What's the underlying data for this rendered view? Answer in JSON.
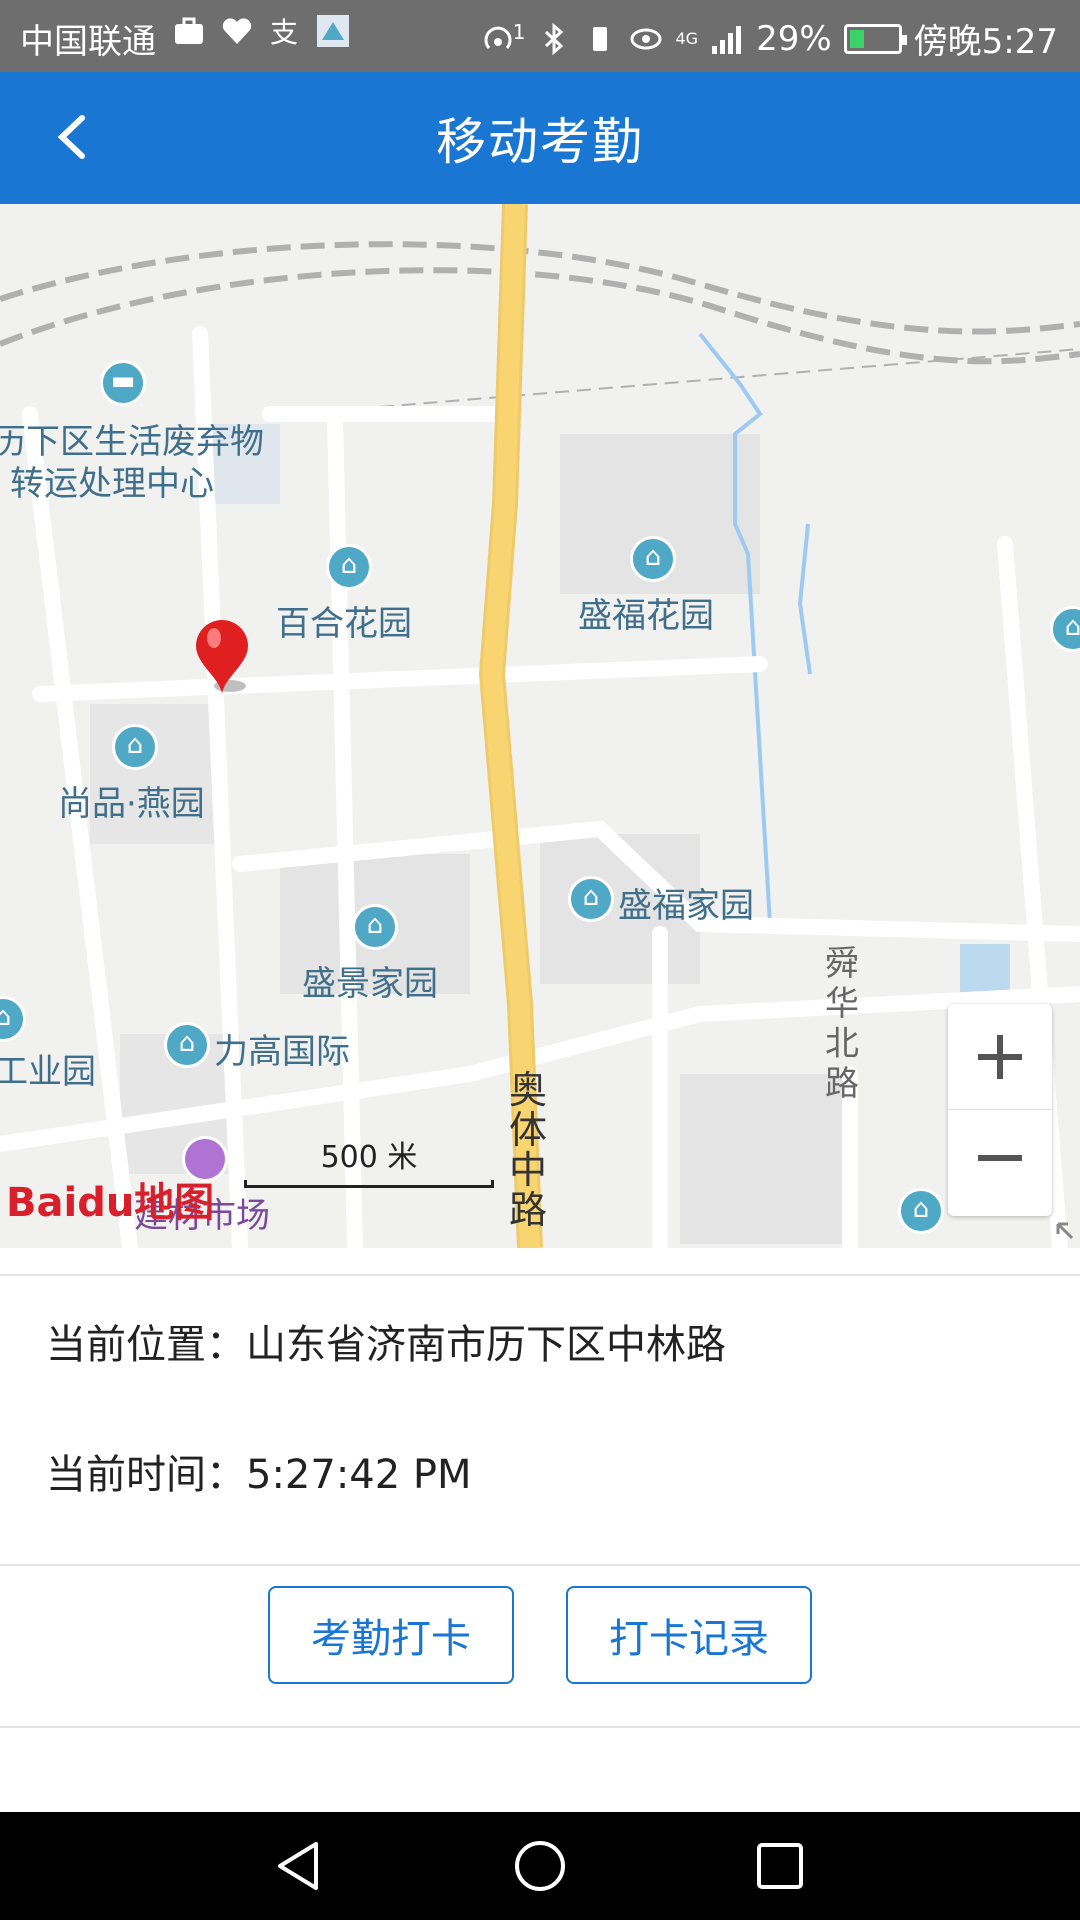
{
  "status_bar": {
    "carrier": "中国联通",
    "signal_network": "4G",
    "battery_percent": "29%",
    "battery_level": 0.29,
    "time": "傍晚5:27",
    "notification_badge": "1",
    "icons": [
      "briefcase-icon",
      "health-icon",
      "alipay-icon",
      "app-icon",
      "hotspot-icon",
      "bluetooth-icon",
      "eye-icon",
      "signal-icon",
      "battery-icon"
    ]
  },
  "app_bar": {
    "title": "移动考勤",
    "back_icon": "chevron-left-icon"
  },
  "map": {
    "pois": [
      {
        "name": "力下区生活废弃物转运处理中心",
        "line1": "历下区生活废弃物",
        "line2": "转运处理中心"
      },
      {
        "name": "百合花园"
      },
      {
        "name": "盛福花园"
      },
      {
        "name": "尚品·燕园"
      },
      {
        "name": "盛福家园"
      },
      {
        "name": "盛景家园"
      },
      {
        "name": "力高国际"
      },
      {
        "name": "工业园"
      },
      {
        "name": "建材市场"
      }
    ],
    "roads": {
      "aoti": "奥体中路",
      "shunhua": "舜华北路"
    },
    "scale_label": "500 米",
    "logo_text": "Baidu地图",
    "zoom_in": "+",
    "zoom_out": "−",
    "colors": {
      "highway": "#f9d571",
      "water": "#9ec9f0",
      "pin": "#e02020",
      "poi": "#4fa9c6"
    }
  },
  "info": {
    "location_label": "当前位置：",
    "location_value": "山东省济南市历下区中林路",
    "time_label": "当前时间：",
    "time_value": "5:27:42 PM"
  },
  "actions": {
    "clock_in": "考勤打卡",
    "records": "打卡记录"
  },
  "nav_bar": {
    "back": "back-triangle-icon",
    "home": "home-circle-icon",
    "recent": "recent-square-icon"
  }
}
